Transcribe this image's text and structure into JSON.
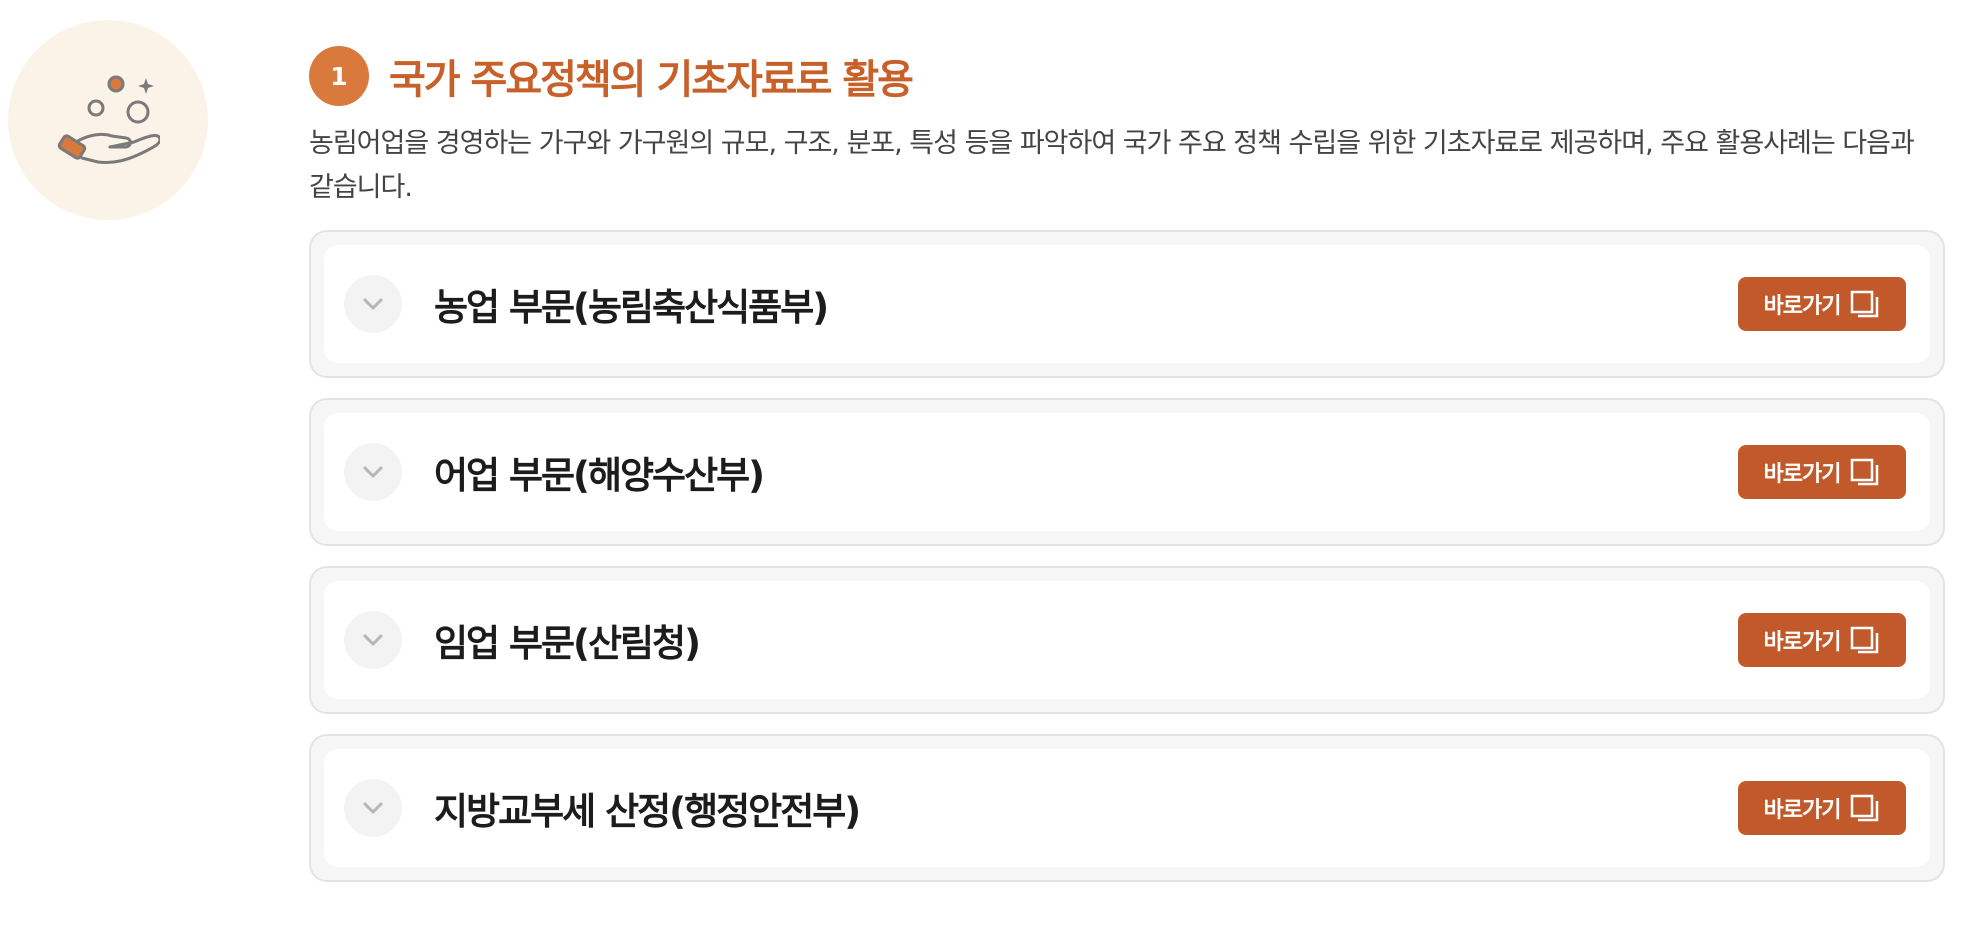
{
  "section": {
    "icon": "hand-with-coins-icon",
    "number": "1",
    "title": "국가 주요정책의 기초자료로 활용",
    "description": "농림어업을 경영하는 가구와 가구원의 규모, 구조, 분포, 특성 등을 파악하여 국가 주요 정책 수립을 위한 기초자료로 제공하며, 주요 활용사례는 다음과 같습니다."
  },
  "accordion": {
    "items": [
      {
        "title": "농업 부문(농림축산식품부)",
        "link_label": "바로가기",
        "expanded": false
      },
      {
        "title": "어업 부문(해양수산부)",
        "link_label": "바로가기",
        "expanded": false
      },
      {
        "title": "임업 부문(산림청)",
        "link_label": "바로가기",
        "expanded": false
      },
      {
        "title": "지방교부세 산정(행정안전부)",
        "link_label": "바로가기",
        "expanded": false
      }
    ]
  },
  "colors": {
    "accent": "#d9793c",
    "title": "#c8602a",
    "button": "#c2592a",
    "icon_bg": "#fbf3e8"
  }
}
